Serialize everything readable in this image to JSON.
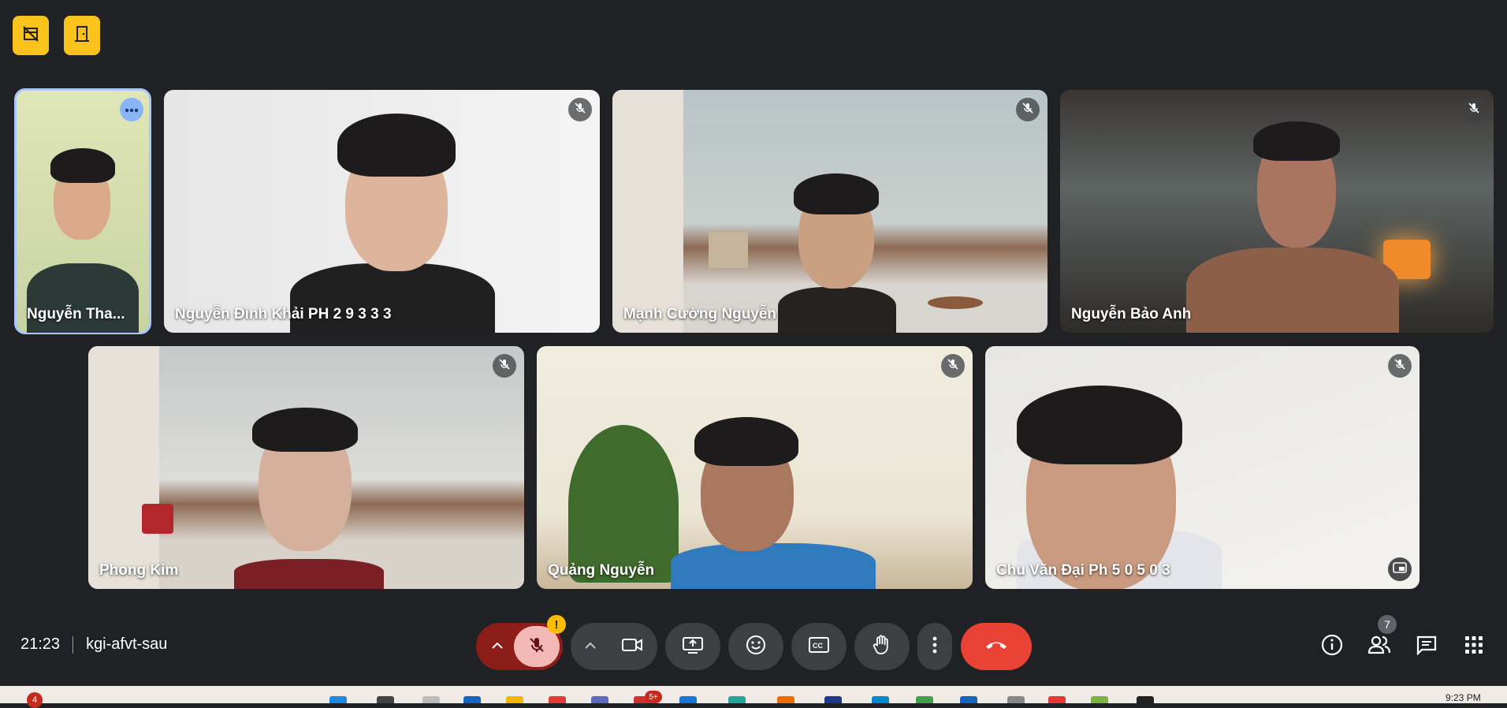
{
  "top_buttons": [
    {
      "icon": "no-video-layout-icon"
    },
    {
      "icon": "door-exit-icon"
    }
  ],
  "participants": [
    {
      "name": "Nguyễn Tha...",
      "muted": false,
      "active": true
    },
    {
      "name": "Nguyễn Đình Khải PH 2 9 3 3 3",
      "muted": true
    },
    {
      "name": "Mạnh Cường Nguyễn",
      "muted": true
    },
    {
      "name": "Nguyễn Bảo Anh",
      "muted": true
    },
    {
      "name": "Phong Kim",
      "muted": true
    },
    {
      "name": "Quảng Nguyễn",
      "muted": true
    },
    {
      "name": "Chu Văn Đại Ph 5 0 5 0 3",
      "muted": true
    }
  ],
  "meeting": {
    "time": "21:23",
    "code": "kgi-afvt-sau"
  },
  "controls": {
    "mic_warning": "!",
    "participant_count": "7"
  },
  "taskbar": {
    "badge_left": "4",
    "badge_app": "5+",
    "clock": "9:23 PM"
  },
  "colors": {
    "background": "#202124",
    "accent_yellow": "#f9c31c",
    "end_call": "#ea4335",
    "mic_off": "#f2b8b5",
    "active_outline": "#a8c7fa"
  }
}
